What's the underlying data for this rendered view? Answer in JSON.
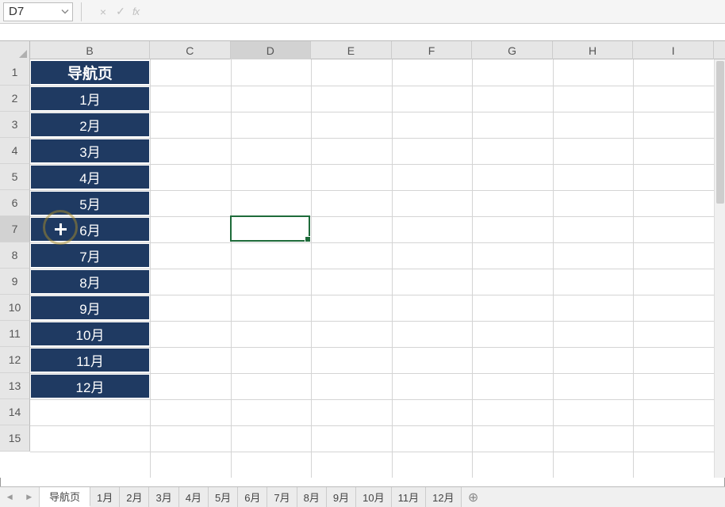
{
  "nameBox": {
    "value": "D7"
  },
  "formulaBar": {
    "cancel_icon": "×",
    "enter_icon": "✓",
    "fx_label": "fx",
    "value": ""
  },
  "columns": [
    "B",
    "C",
    "D",
    "E",
    "F",
    "G",
    "H",
    "I"
  ],
  "active_column_index": 2,
  "rows": [
    1,
    2,
    3,
    4,
    5,
    6,
    7,
    8,
    9,
    10,
    11,
    12,
    13,
    14,
    15
  ],
  "active_row_index": 6,
  "columnB": {
    "header": "导航页",
    "items": [
      "1月",
      "2月",
      "3月",
      "4月",
      "5月",
      "6月",
      "7月",
      "8月",
      "9月",
      "10月",
      "11月",
      "12月"
    ]
  },
  "sheets": {
    "active": "导航页",
    "list": [
      "导航页",
      "1月",
      "2月",
      "3月",
      "4月",
      "5月",
      "6月",
      "7月",
      "8月",
      "9月",
      "10月",
      "11月",
      "12月"
    ],
    "add_icon": "⊕"
  },
  "nav": {
    "prev": "◀",
    "next": "▶"
  }
}
